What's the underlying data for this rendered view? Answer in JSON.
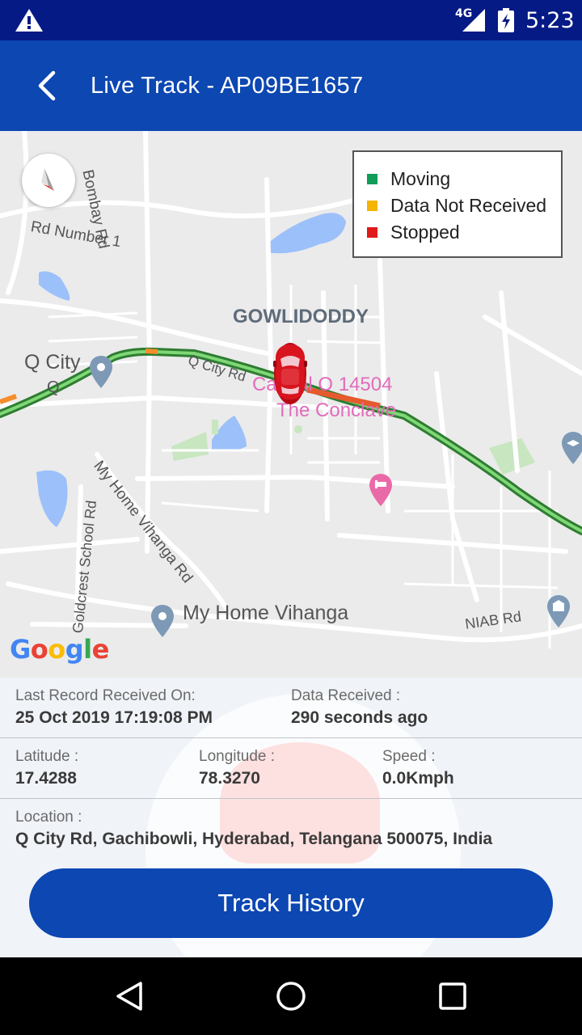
{
  "status_bar": {
    "network": "4G",
    "time": "5:23",
    "icons": [
      "warning-icon",
      "signal-icon",
      "battery-charging-icon"
    ]
  },
  "app_bar": {
    "title": "Live Track - AP09BE1657",
    "back_icon": "back-arrow-icon"
  },
  "map": {
    "compass_icon": "compass-icon",
    "legend": [
      {
        "label": "Moving",
        "color": "#0f9d58"
      },
      {
        "label": "Data Not Received",
        "color": "#f4b400"
      },
      {
        "label": "Stopped",
        "color": "#e01a1a"
      }
    ],
    "labels": {
      "bombay_rd": "Bombay Rd",
      "rd_number_1": "Rd Number 1",
      "gowlidoddy": "GOWLIDODDY",
      "q_city": "Q City",
      "q_city_short": "Q",
      "q_city_rd": "Q City Rd",
      "capital_o": "Capital O 14504",
      "the_conclave": "The Conclave",
      "my_home_vihanga_rd": "My Home Vihanga Rd",
      "goldcrest_school_rd": "Goldcrest School Rd",
      "my_home_vihanga": "My Home Vihanga",
      "niab_rd": "NIAB Rd"
    },
    "brand": "Google",
    "vehicle_icon": "car-icon",
    "route_color": "#3aaa35"
  },
  "info": {
    "last_record_label": "Last Record Received On:",
    "last_record_value": "25 Oct 2019 17:19:08 PM",
    "data_received_label": "Data Received :",
    "data_received_value": "290 seconds ago",
    "latitude_label": "Latitude :",
    "latitude_value": "17.4288",
    "longitude_label": "Longitude :",
    "longitude_value": "78.3270",
    "speed_label": "Speed :",
    "speed_value": "0.0Kmph",
    "location_label": "Location :",
    "location_value": "Q City Rd, Gachibowli, Hyderabad, Telangana 500075, India",
    "track_history_label": "Track History"
  },
  "nav_bar": {
    "icons": [
      "back-triangle-icon",
      "home-circle-icon",
      "recents-square-icon"
    ]
  }
}
